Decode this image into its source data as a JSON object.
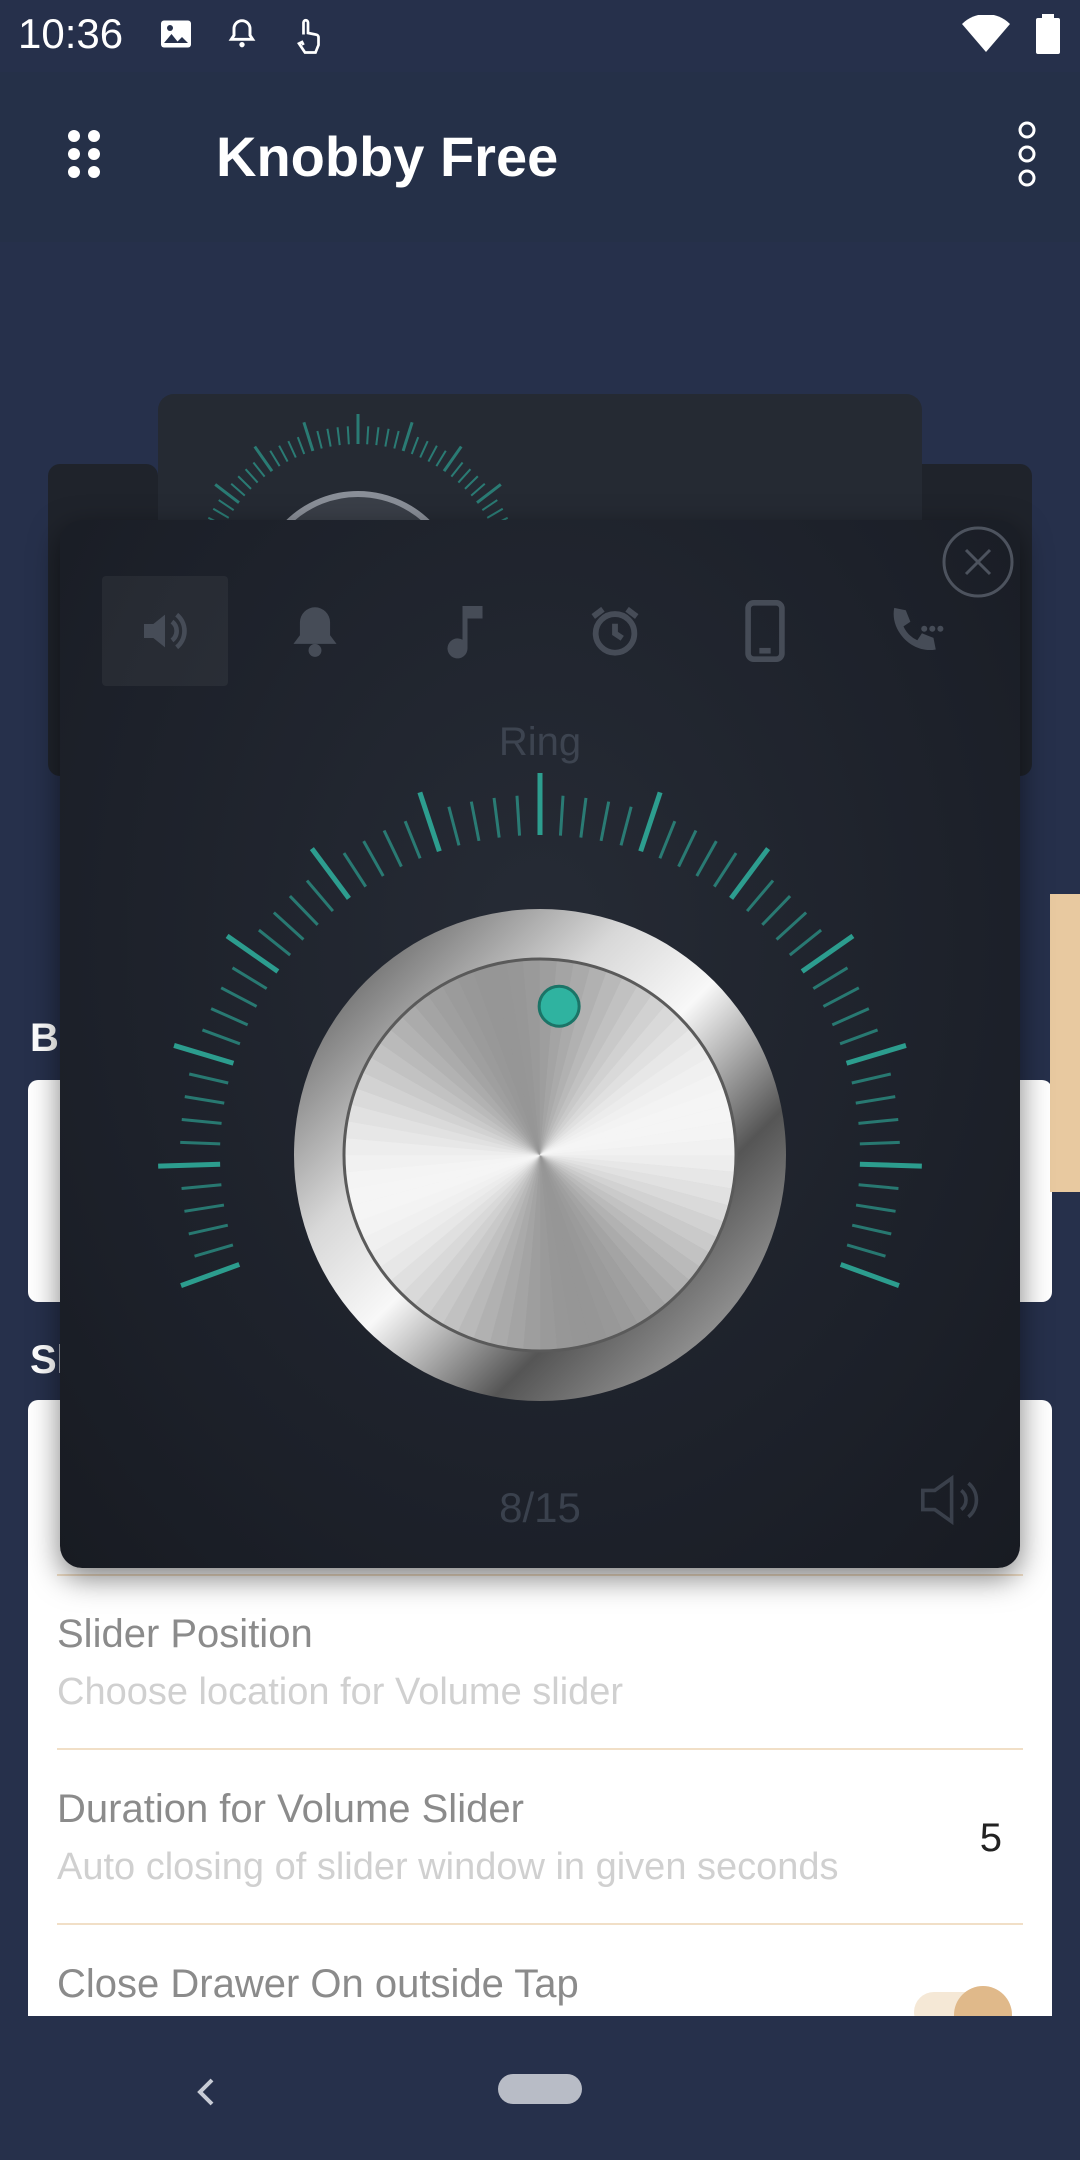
{
  "status_bar": {
    "time": "10:36",
    "icons_left": [
      "image-icon",
      "bell-icon",
      "touch-icon"
    ],
    "icons_right": [
      "wifi-icon",
      "battery-icon"
    ]
  },
  "app_bar": {
    "title": "Knobby Free",
    "menu_icon": "grid-dots-icon",
    "more_icon": "more-vert-icon"
  },
  "sections": [
    {
      "label_fragment": "Bo"
    },
    {
      "label_fragment": "Sl"
    }
  ],
  "settings": [
    {
      "title": "Slider Position",
      "subtitle": "Choose location for Volume slider"
    },
    {
      "title": "Duration for Volume Slider",
      "subtitle": "Auto closing of slider window in given seconds",
      "value": "5"
    },
    {
      "title": "Close Drawer On outside Tap",
      "toggle_on": true
    }
  ],
  "popup": {
    "tabs": [
      "volume-icon",
      "bell-icon",
      "music-note-icon",
      "alarm-icon",
      "phone-icon",
      "call-icon"
    ],
    "active_tab": 0,
    "stream_label": "Ring",
    "volume_text": "8/15",
    "volume_level": 8,
    "volume_max": 15,
    "accent_color": "#2fb3a0"
  },
  "nav": {
    "back_icon": "back-chevron-icon",
    "home_icon": "home-pill-icon"
  }
}
